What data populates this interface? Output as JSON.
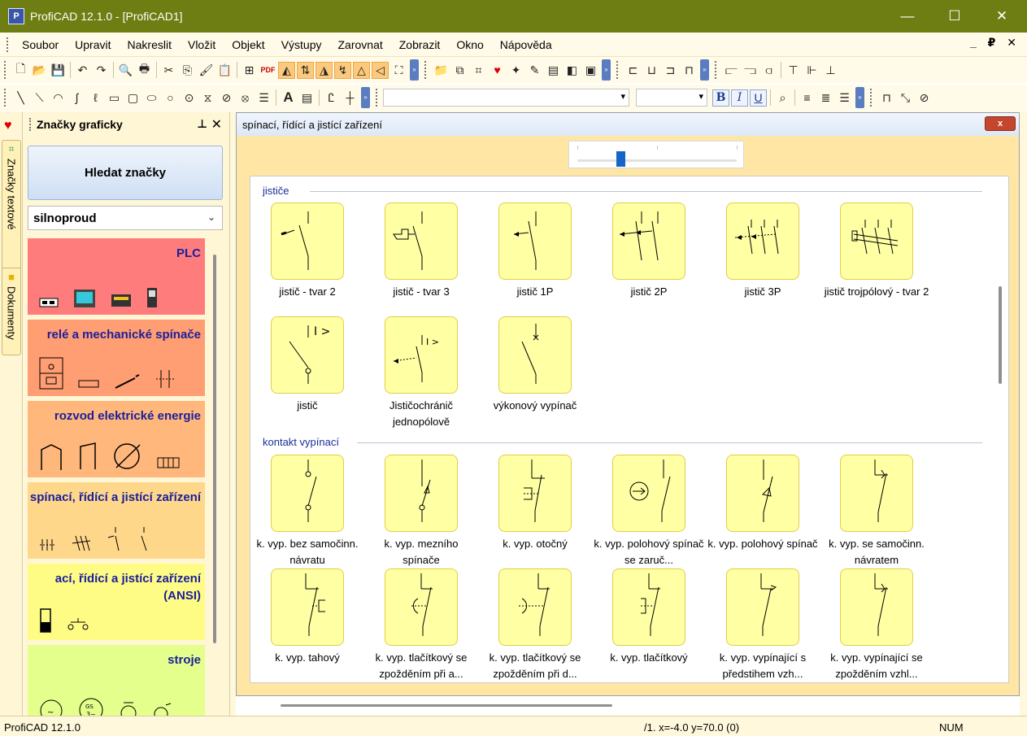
{
  "window": {
    "title": "ProfiCAD 12.1.0 - [ProfiCAD1]",
    "logo_text": "P",
    "minimize": "—",
    "maximize": "☐",
    "close": "✕"
  },
  "menu": {
    "items": [
      "Soubor",
      "Upravit",
      "Nakreslit",
      "Vložit",
      "Objekt",
      "Výstupy",
      "Zarovnat",
      "Zobrazit",
      "Okno",
      "Nápověda"
    ],
    "right": "_ ₽ ✕"
  },
  "toolbar1": {
    "icons": [
      "new-file-icon",
      "open-folder-icon",
      "save-icon",
      "undo-icon",
      "redo-icon",
      "print-preview-icon",
      "print-icon",
      "cut-icon",
      "copy-icon",
      "paste-format-icon",
      "paste-icon",
      "properties-icon",
      "pdf-icon",
      "mirror-horizontal-icon",
      "mirror-vertical-icon",
      "rotate-left-icon",
      "rotate-right-icon",
      "flip-icon",
      "arrow-left-icon",
      "fullscreen-icon",
      "folder-icon",
      "hierarchy-icon",
      "connect-icon",
      "heart-icon",
      "sparkle-icon",
      "edit-icon",
      "layers-icon",
      "bring-front-icon",
      "frame-icon",
      "align-left-box-icon",
      "align-center-box-icon",
      "align-right-box-icon",
      "group-icon",
      "align-bars-left-icon",
      "align-bars-center-icon",
      "align-bars-right-icon",
      "distribute-top-icon",
      "distribute-mid-icon",
      "distribute-bottom-icon"
    ]
  },
  "toolbar2": {
    "text_bold": "B",
    "text_italic": "I",
    "text_underline": "U",
    "font_value": "",
    "size_value": "",
    "text_tool": "A"
  },
  "side_tabs": {
    "textove": "Značky textové",
    "dokumenty": "Dokumenty"
  },
  "panel": {
    "title": "Značky graficky",
    "pin": "ꟷ",
    "close": "✕",
    "search_label": "Hledat značky",
    "category": "silnoproud",
    "chevron": "⌄",
    "categories": [
      {
        "title": "PLC",
        "color": "#ff7c7c"
      },
      {
        "title": "relé a mechanické spínače",
        "color": "#ff9d73"
      },
      {
        "title": "rozvod elektrické energie",
        "color": "#ffb77c"
      },
      {
        "title": "spínací, řídící a jistící zařízení",
        "color": "#ffd78b"
      },
      {
        "title": "ací, řídící a jistící zařízení (ANSI)",
        "color": "#fffc86"
      },
      {
        "title": "stroje",
        "color": "#e4ff8b"
      }
    ]
  },
  "document": {
    "title": "spínací, řídící a jistící zařízení",
    "close": "x",
    "zoom_value": 0.27,
    "sections": [
      {
        "title": "jističe",
        "items": [
          "jistič - tvar 2",
          "jistič - tvar 3",
          "jistič 1P",
          "jistič 2P",
          "jistič 3P",
          "jistič trojpólový - tvar 2",
          "jistič",
          "Jističochránič jednopólově",
          "výkonový vypínač"
        ]
      },
      {
        "title": "kontakt vypínací",
        "items": [
          "k. vyp. bez samočinn. návratu",
          "k. vyp. mezního spínače",
          "k. vyp. otočný",
          "k. vyp. polohový spínač se zaruč...",
          "k. vyp. polohový spínač",
          "k. vyp. se samočinn. návratem",
          "k. vyp. tahový",
          "k. vyp. tlačítkový se zpožděním při a...",
          "k. vyp. tlačítkový se zpožděním při d...",
          "k. vyp. tlačítkový",
          "k. vyp. vypínající s předstihem vzh...",
          "k. vyp. vypínající se zpožděním vzhl..."
        ]
      }
    ]
  },
  "status": {
    "left": "ProfiCAD 12.1.0",
    "coords": "/1. x=-4.0 y=70.0 (0)",
    "num": "NUM"
  },
  "colors": {
    "titlebar": "#6f7e12",
    "section_text": "#1a2c98",
    "symbol_fill": "#ffffa4",
    "category_text": "#1a1f9a"
  }
}
